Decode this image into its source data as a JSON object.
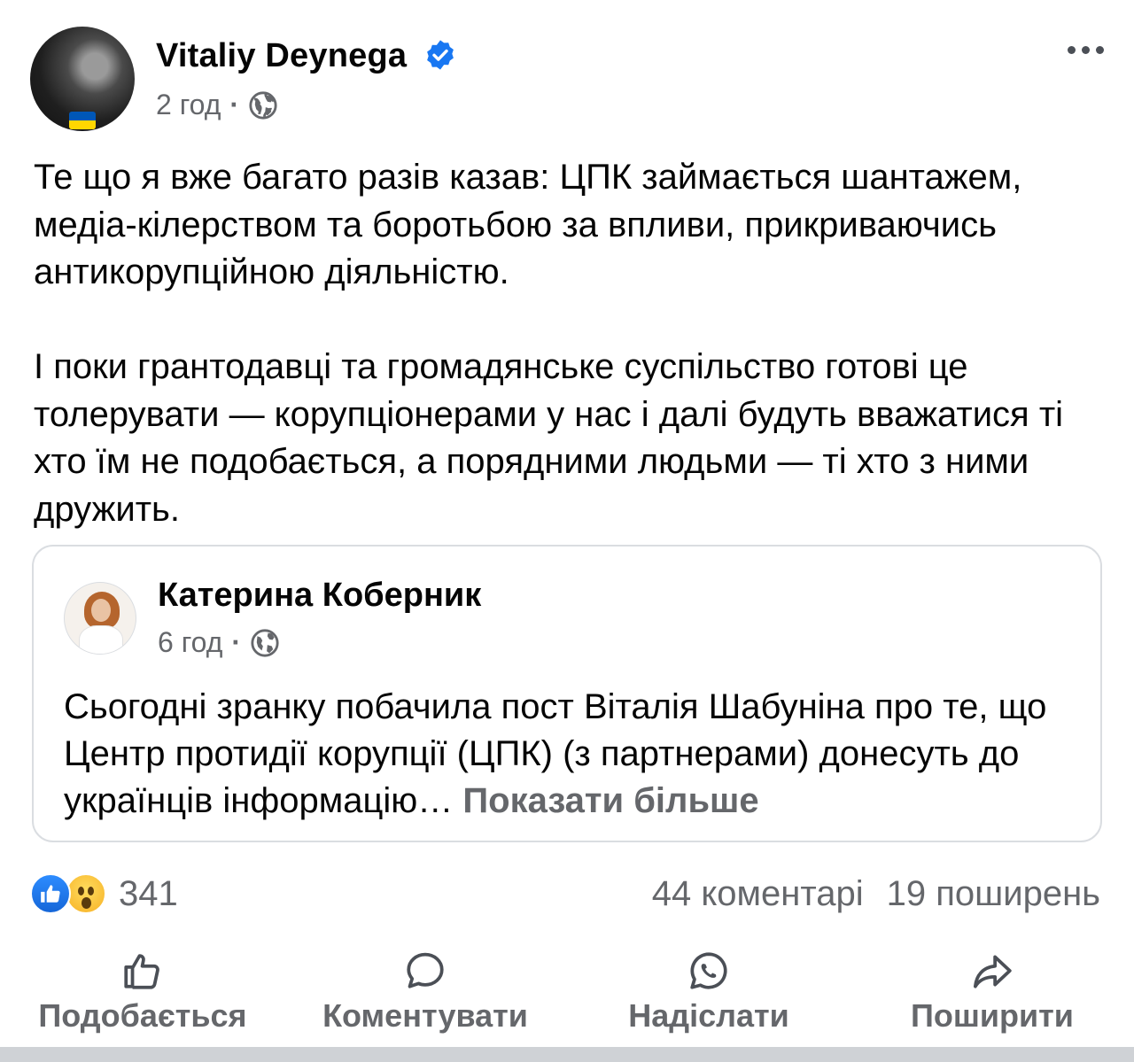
{
  "post": {
    "author": "Vitaliy Deynega",
    "time": "2 год",
    "paragraphs": [
      "Те що я вже багато разів казав: ЦПК займається шантажем, медіа-кілерством та боротьбою за впливи, прикриваючись антикорупційною діяльністю.",
      "І поки грантодавці та громадянське суспільство готові це толерувати — корупціонерами у нас і далі будуть вважатися ті хто їм не подобається, а порядними людьми — ті хто з ними дружить."
    ]
  },
  "shared": {
    "author": "Катерина Коберник",
    "time": "6 год",
    "text": "Сьогодні зранку побачила пост Віталія Шабуніна про те, що Центр протидії корупції (ЦПК) (з партнерами) донесуть до українців інформацію… ",
    "see_more": "Показати більше"
  },
  "stats": {
    "reactions_count": "341",
    "comments": "44 коментарі",
    "shares": "19 поширень"
  },
  "actions": {
    "like": "Подобається",
    "comment": "Коментувати",
    "send": "Надіслати",
    "share": "Поширити"
  },
  "icons": {
    "verified": "verified-badge-icon",
    "privacy": "globe-icon",
    "more": "more-dots-icon",
    "like_reaction": "like-reaction-icon",
    "wow_reaction": "wow-reaction-icon"
  },
  "colors": {
    "accent": "#1877f2",
    "secondary_text": "#65676b",
    "primary_text": "#050505"
  }
}
